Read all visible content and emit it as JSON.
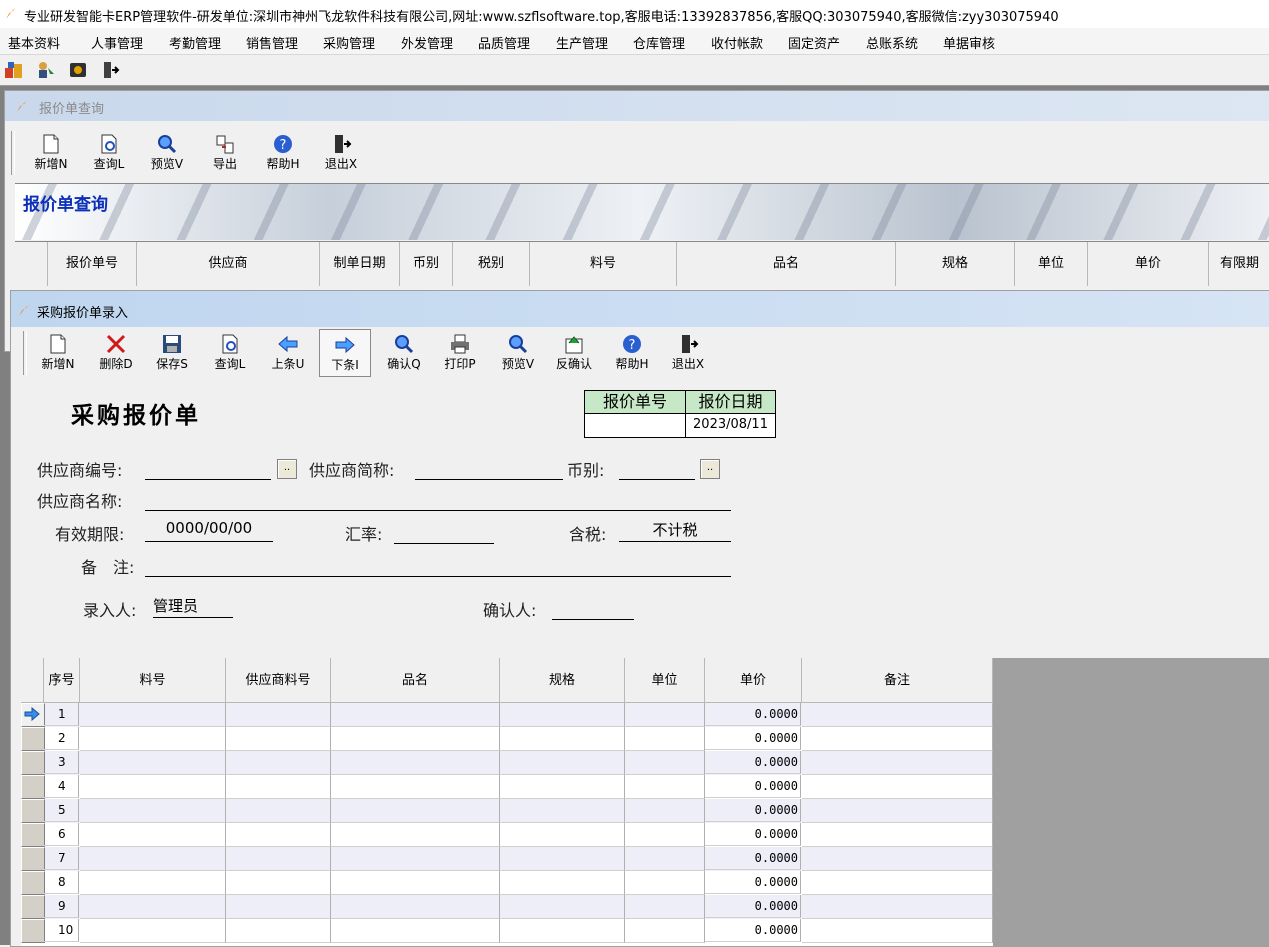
{
  "app": {
    "title": "专业研发智能卡ERP管理软件-研发单位:深圳市神州飞龙软件科技有限公司,网址:www.szflsoftware.top,客服电话:13392837856,客服QQ:303075940,客服微信:zyy303075940"
  },
  "menu": [
    "基本资料",
    "人事管理",
    "考勤管理",
    "销售管理",
    "采购管理",
    "外发管理",
    "品质管理",
    "生产管理",
    "仓库管理",
    "收付帐款",
    "固定资产",
    "总账系统",
    "单据审核"
  ],
  "query_window": {
    "title": "报价单查询",
    "toolbar": [
      "新增N",
      "查询L",
      "预览V",
      "导出",
      "帮助H",
      "退出X"
    ],
    "banner": "报价单查询",
    "columns": [
      "报价单号",
      "供应商",
      "制单日期",
      "币别",
      "税别",
      "料号",
      "品名",
      "规格",
      "单位",
      "单价",
      "有限期"
    ]
  },
  "entry_window": {
    "title": "采购报价单录入",
    "toolbar": [
      "新增N",
      "删除D",
      "保存S",
      "查询L",
      "上条U",
      "下条I",
      "确认Q",
      "打印P",
      "预览V",
      "反确认",
      "帮助H",
      "退出X"
    ],
    "form_title": "采购报价单",
    "number_box": {
      "no_label": "报价单号",
      "no_value": "",
      "date_label": "报价日期",
      "date_value": "2023/08/11"
    },
    "fields": {
      "supplier_code_label": "供应商编号:",
      "supplier_code": "",
      "supplier_short_label": "供应商简称:",
      "supplier_short": "",
      "currency_label": "币别:",
      "currency": "",
      "supplier_name_label": "供应商名称:",
      "supplier_name": "",
      "valid_label": "有效期限:",
      "valid_value": "0000/00/00",
      "rate_label": "汇率:",
      "rate_value": "",
      "tax_label": "含税:",
      "tax_value": "不计税",
      "remark_label": "备　注:",
      "remark_value": "",
      "entered_by_label": "录入人:",
      "entered_by": "管理员",
      "confirmed_by_label": "确认人:",
      "confirmed_by": ""
    },
    "grid": {
      "columns": [
        "序号",
        "料号",
        "供应商料号",
        "品名",
        "规格",
        "单位",
        "单价",
        "备注"
      ],
      "rows": [
        {
          "no": "1",
          "price": "0.0000"
        },
        {
          "no": "2",
          "price": "0.0000"
        },
        {
          "no": "3",
          "price": "0.0000"
        },
        {
          "no": "4",
          "price": "0.0000"
        },
        {
          "no": "5",
          "price": "0.0000"
        },
        {
          "no": "6",
          "price": "0.0000"
        },
        {
          "no": "7",
          "price": "0.0000"
        },
        {
          "no": "8",
          "price": "0.0000"
        },
        {
          "no": "9",
          "price": "0.0000"
        },
        {
          "no": "10",
          "price": "0.0000"
        }
      ]
    }
  },
  "colors": {
    "banner_text": "#0a2fb8",
    "number_box_header": "#c6e8c6",
    "row_alt": "#eeeef9"
  }
}
